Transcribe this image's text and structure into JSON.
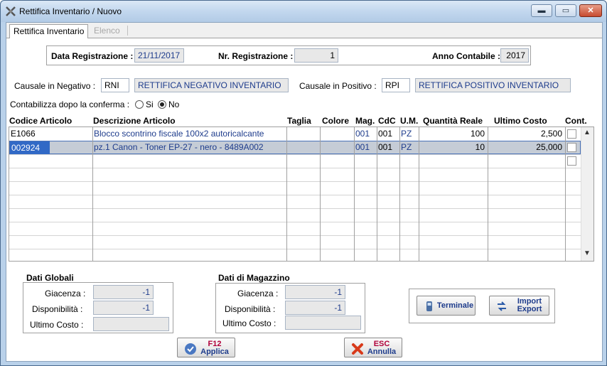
{
  "window": {
    "title": "Rettifica Inventario / Nuovo"
  },
  "tabs": [
    {
      "label": "Rettifica Inventario"
    },
    {
      "label": "Elenco"
    }
  ],
  "header": {
    "data_label": "Data Registrazione :",
    "data_value": "21/11/2017",
    "nr_label": "Nr. Registrazione :",
    "nr_value": "1",
    "anno_label": "Anno Contabile :",
    "anno_value": "2017"
  },
  "causale": {
    "neg_label": "Causale in Negativo :",
    "neg_code": "RNI",
    "neg_desc": "RETTIFICA NEGATIVO INVENTARIO",
    "pos_label": "Causale in Positivo :",
    "pos_code": "RPI",
    "pos_desc": "RETTIFICA POSITIVO INVENTARIO"
  },
  "contabilizza": {
    "label": "Contabilizza dopo la conferma :",
    "si": "Si",
    "no": "No",
    "selected": "No"
  },
  "grid": {
    "headers": [
      "Codice Articolo",
      "Descrizione Articolo",
      "Taglia",
      "Colore",
      "Mag.",
      "CdC",
      "U.M.",
      "Quantità Reale",
      "Ultimo Costo",
      "Cont."
    ],
    "rows": [
      {
        "codice": "E1066",
        "descrizione": "Blocco scontrino fiscale 100x2 autoricalcante",
        "taglia": "",
        "colore": "",
        "mag": "001",
        "cdc": "001",
        "um": "PZ",
        "qta": "100",
        "costo": "2,500"
      },
      {
        "codice": "002924",
        "descrizione": "pz.1 Canon - Toner EP-27 - nero - 8489A002",
        "taglia": "",
        "colore": "",
        "mag": "001",
        "cdc": "001",
        "um": "PZ",
        "qta": "10",
        "costo": "25,000"
      }
    ]
  },
  "dati_globali": {
    "title": "Dati Globali",
    "giacenza_label": "Giacenza :",
    "giacenza": "-1",
    "disp_label": "Disponibilità :",
    "disp": "-1",
    "costo_label": "Ultimo Costo :",
    "costo": ""
  },
  "dati_magazzino": {
    "title": "Dati di Magazzino",
    "giacenza_label": "Giacenza :",
    "giacenza": "-1",
    "disp_label": "Disponibilità :",
    "disp": "-1",
    "costo_label": "Ultimo Costo :",
    "costo": ""
  },
  "buttons": {
    "terminale": "Terminale",
    "import_l1": "Import",
    "import_l2": "Export",
    "f12_l1": "F12",
    "f12_l2": "Applica",
    "esc_l1": "ESC",
    "esc_l2": "Annulla"
  }
}
